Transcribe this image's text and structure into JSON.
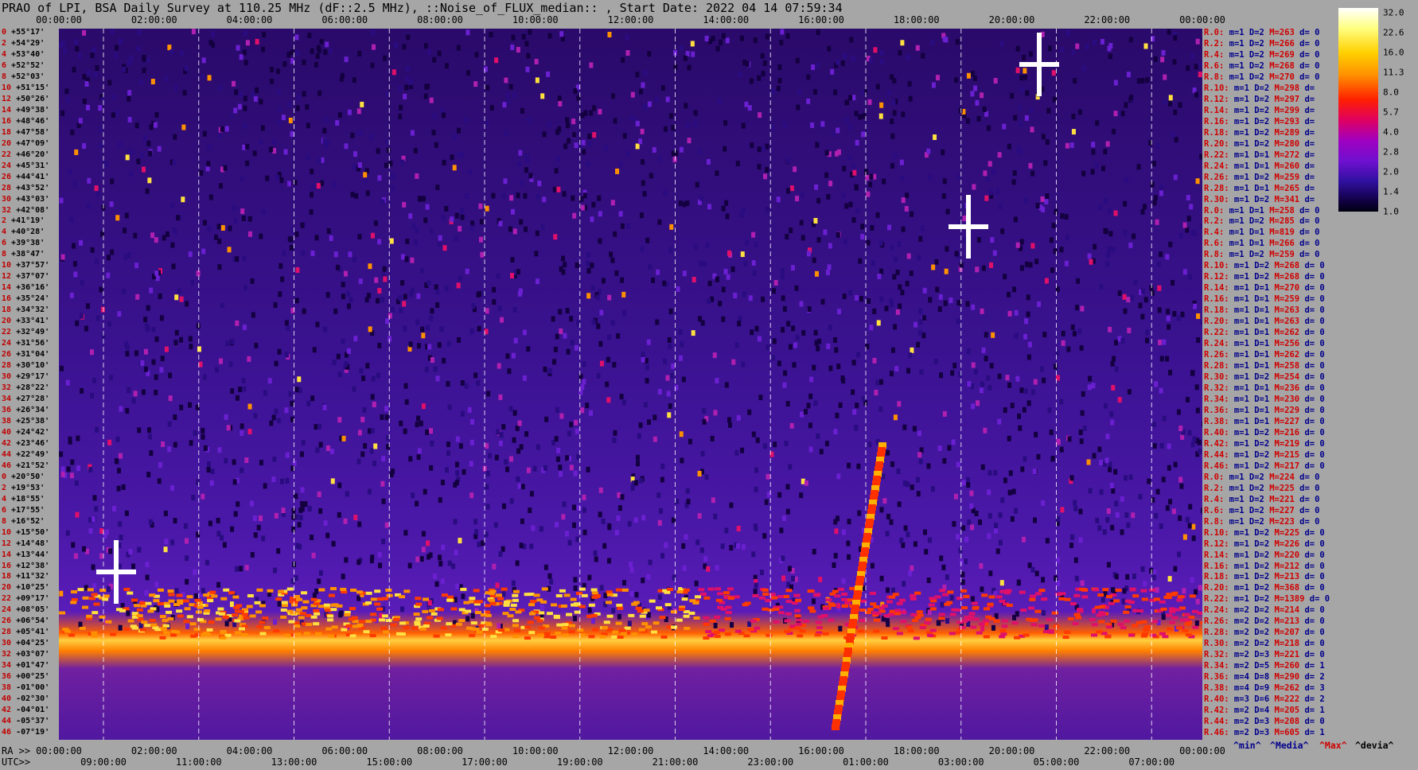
{
  "title": "PRAO of LPI, BSA Daily Survey at 110.25 MHz (dF::2.5 MHz), ::Noise_of_FLUX_median:: , Start Date: 2022 04 14 07:59:34",
  "chart_data": {
    "type": "heatmap",
    "title": "PRAO of LPI, BSA Daily Survey at 110.25 MHz (dF::2.5 MHz), ::Noise_of_FLUX_median:: , Start Date: 2022 04 14 07:59:34",
    "x_top_ticks": [
      "00:00:00",
      "02:00:00",
      "04:00:00",
      "06:00:00",
      "08:00:00",
      "10:00:00",
      "12:00:00",
      "14:00:00",
      "16:00:00",
      "18:00:00",
      "20:00:00",
      "22:00:00",
      "00:00:00"
    ],
    "x_bottom_ra_ticks": [
      "00:00:00",
      "02:00:00",
      "04:00:00",
      "06:00:00",
      "08:00:00",
      "10:00:00",
      "12:00:00",
      "14:00:00",
      "16:00:00",
      "18:00:00",
      "20:00:00",
      "22:00:00",
      "00:00:00"
    ],
    "x_bottom_utc_ticks": [
      "09:00:00",
      "11:00:00",
      "13:00:00",
      "15:00:00",
      "17:00:00",
      "19:00:00",
      "21:00:00",
      "23:00:00",
      "01:00:00",
      "03:00:00",
      "05:00:00",
      "07:00:00"
    ],
    "ra_label": "RA >>",
    "utc_label": "UTC>>",
    "declinations": [
      {
        "i": "0",
        "d": "+55°17'"
      },
      {
        "i": "2",
        "d": "+54°29'"
      },
      {
        "i": "4",
        "d": "+53°40'"
      },
      {
        "i": "6",
        "d": "+52°52'"
      },
      {
        "i": "8",
        "d": "+52°03'"
      },
      {
        "i": "10",
        "d": "+51°15'"
      },
      {
        "i": "12",
        "d": "+50°26'"
      },
      {
        "i": "14",
        "d": "+49°38'"
      },
      {
        "i": "16",
        "d": "+48°46'"
      },
      {
        "i": "18",
        "d": "+47°58'"
      },
      {
        "i": "20",
        "d": "+47°09'"
      },
      {
        "i": "22",
        "d": "+46°20'"
      },
      {
        "i": "24",
        "d": "+45°31'"
      },
      {
        "i": "26",
        "d": "+44°41'"
      },
      {
        "i": "28",
        "d": "+43°52'"
      },
      {
        "i": "30",
        "d": "+43°03'"
      },
      {
        "i": "32",
        "d": "+42°08'"
      },
      {
        "i": "2",
        "d": "+41°19'"
      },
      {
        "i": "4",
        "d": "+40°28'"
      },
      {
        "i": "6",
        "d": "+39°38'"
      },
      {
        "i": "8",
        "d": "+38°47'"
      },
      {
        "i": "10",
        "d": "+37°57'"
      },
      {
        "i": "12",
        "d": "+37°07'"
      },
      {
        "i": "14",
        "d": "+36°16'"
      },
      {
        "i": "16",
        "d": "+35°24'"
      },
      {
        "i": "18",
        "d": "+34°32'"
      },
      {
        "i": "20",
        "d": "+33°41'"
      },
      {
        "i": "22",
        "d": "+32°49'"
      },
      {
        "i": "24",
        "d": "+31°56'"
      },
      {
        "i": "26",
        "d": "+31°04'"
      },
      {
        "i": "28",
        "d": "+30°10'"
      },
      {
        "i": "30",
        "d": "+29°17'"
      },
      {
        "i": "32",
        "d": "+28°22'"
      },
      {
        "i": "34",
        "d": "+27°28'"
      },
      {
        "i": "36",
        "d": "+26°34'"
      },
      {
        "i": "38",
        "d": "+25°38'"
      },
      {
        "i": "40",
        "d": "+24°42'"
      },
      {
        "i": "42",
        "d": "+23°46'"
      },
      {
        "i": "44",
        "d": "+22°49'"
      },
      {
        "i": "46",
        "d": "+21°52'"
      },
      {
        "i": "0",
        "d": "+20°50'"
      },
      {
        "i": "2",
        "d": "+19°53'"
      },
      {
        "i": "4",
        "d": "+18°55'"
      },
      {
        "i": "6",
        "d": "+17°55'"
      },
      {
        "i": "8",
        "d": "+16°52'"
      },
      {
        "i": "10",
        "d": "+15°50'"
      },
      {
        "i": "12",
        "d": "+14°48'"
      },
      {
        "i": "14",
        "d": "+13°44'"
      },
      {
        "i": "16",
        "d": "+12°38'"
      },
      {
        "i": "18",
        "d": "+11°32'"
      },
      {
        "i": "20",
        "d": "+10°25'"
      },
      {
        "i": "22",
        "d": "+09°17'"
      },
      {
        "i": "24",
        "d": "+08°05'"
      },
      {
        "i": "26",
        "d": "+06°54'"
      },
      {
        "i": "28",
        "d": "+05°41'"
      },
      {
        "i": "30",
        "d": "+04°25'"
      },
      {
        "i": "32",
        "d": "+03°07'"
      },
      {
        "i": "34",
        "d": "+01°47'"
      },
      {
        "i": "36",
        "d": "+00°25'"
      },
      {
        "i": "38",
        "d": "-01°00'"
      },
      {
        "i": "40",
        "d": "-02°30'"
      },
      {
        "i": "42",
        "d": "-04°01'"
      },
      {
        "i": "44",
        "d": "-05°37'"
      },
      {
        "i": "46",
        "d": "-07°19'"
      }
    ],
    "right_stats": [
      {
        "r": "R.0:",
        "m": "m=1",
        "dd": "D=2",
        "mx": "M=263",
        "dv": "d= 0"
      },
      {
        "r": "R.2:",
        "m": "m=1",
        "dd": "D=2",
        "mx": "M=266",
        "dv": "d= 0"
      },
      {
        "r": "R.4:",
        "m": "m=1",
        "dd": "D=2",
        "mx": "M=269",
        "dv": "d= 0"
      },
      {
        "r": "R.6:",
        "m": "m=1",
        "dd": "D=2",
        "mx": "M=268",
        "dv": "d= 0"
      },
      {
        "r": "R.8:",
        "m": "m=1",
        "dd": "D=2",
        "mx": "M=270",
        "dv": "d= 0"
      },
      {
        "r": "R.10:",
        "m": "m=1",
        "dd": "D=2",
        "mx": "M=298",
        "dv": "d="
      },
      {
        "r": "R.12:",
        "m": "m=1",
        "dd": "D=2",
        "mx": "M=297",
        "dv": "d="
      },
      {
        "r": "R.14:",
        "m": "m=1",
        "dd": "D=2",
        "mx": "M=299",
        "dv": "d="
      },
      {
        "r": "R.16:",
        "m": "m=1",
        "dd": "D=2",
        "mx": "M=293",
        "dv": "d="
      },
      {
        "r": "R.18:",
        "m": "m=1",
        "dd": "D=2",
        "mx": "M=289",
        "dv": "d="
      },
      {
        "r": "R.20:",
        "m": "m=1",
        "dd": "D=2",
        "mx": "M=280",
        "dv": "d="
      },
      {
        "r": "R.22:",
        "m": "m=1",
        "dd": "D=1",
        "mx": "M=272",
        "dv": "d="
      },
      {
        "r": "R.24:",
        "m": "m=1",
        "dd": "D=1",
        "mx": "M=260",
        "dv": "d="
      },
      {
        "r": "R.26:",
        "m": "m=1",
        "dd": "D=2",
        "mx": "M=259",
        "dv": "d="
      },
      {
        "r": "R.28:",
        "m": "m=1",
        "dd": "D=1",
        "mx": "M=265",
        "dv": "d="
      },
      {
        "r": "R.30:",
        "m": "m=1",
        "dd": "D=2",
        "mx": "M=341",
        "dv": "d="
      },
      {
        "r": "R.0:",
        "m": "m=1",
        "dd": "D=1",
        "mx": "M=258",
        "dv": "d= 0"
      },
      {
        "r": "R.2:",
        "m": "m=1",
        "dd": "D=2",
        "mx": "M=285",
        "dv": "d= 0"
      },
      {
        "r": "R.4:",
        "m": "m=1",
        "dd": "D=1",
        "mx": "M=819",
        "dv": "d= 0"
      },
      {
        "r": "R.6:",
        "m": "m=1",
        "dd": "D=1",
        "mx": "M=266",
        "dv": "d= 0"
      },
      {
        "r": "R.8:",
        "m": "m=1",
        "dd": "D=2",
        "mx": "M=259",
        "dv": "d= 0"
      },
      {
        "r": "R.10:",
        "m": "m=1",
        "dd": "D=2",
        "mx": "M=268",
        "dv": "d= 0"
      },
      {
        "r": "R.12:",
        "m": "m=1",
        "dd": "D=2",
        "mx": "M=268",
        "dv": "d= 0"
      },
      {
        "r": "R.14:",
        "m": "m=1",
        "dd": "D=1",
        "mx": "M=270",
        "dv": "d= 0"
      },
      {
        "r": "R.16:",
        "m": "m=1",
        "dd": "D=1",
        "mx": "M=259",
        "dv": "d= 0"
      },
      {
        "r": "R.18:",
        "m": "m=1",
        "dd": "D=1",
        "mx": "M=263",
        "dv": "d= 0"
      },
      {
        "r": "R.20:",
        "m": "m=1",
        "dd": "D=1",
        "mx": "M=263",
        "dv": "d= 0"
      },
      {
        "r": "R.22:",
        "m": "m=1",
        "dd": "D=1",
        "mx": "M=262",
        "dv": "d= 0"
      },
      {
        "r": "R.24:",
        "m": "m=1",
        "dd": "D=1",
        "mx": "M=256",
        "dv": "d= 0"
      },
      {
        "r": "R.26:",
        "m": "m=1",
        "dd": "D=1",
        "mx": "M=262",
        "dv": "d= 0"
      },
      {
        "r": "R.28:",
        "m": "m=1",
        "dd": "D=1",
        "mx": "M=258",
        "dv": "d= 0"
      },
      {
        "r": "R.30:",
        "m": "m=1",
        "dd": "D=2",
        "mx": "M=254",
        "dv": "d= 0"
      },
      {
        "r": "R.32:",
        "m": "m=1",
        "dd": "D=1",
        "mx": "M=236",
        "dv": "d= 0"
      },
      {
        "r": "R.34:",
        "m": "m=1",
        "dd": "D=1",
        "mx": "M=230",
        "dv": "d= 0"
      },
      {
        "r": "R.36:",
        "m": "m=1",
        "dd": "D=1",
        "mx": "M=229",
        "dv": "d= 0"
      },
      {
        "r": "R.38:",
        "m": "m=1",
        "dd": "D=1",
        "mx": "M=227",
        "dv": "d= 0"
      },
      {
        "r": "R.40:",
        "m": "m=1",
        "dd": "D=2",
        "mx": "M=216",
        "dv": "d= 0"
      },
      {
        "r": "R.42:",
        "m": "m=1",
        "dd": "D=2",
        "mx": "M=219",
        "dv": "d= 0"
      },
      {
        "r": "R.44:",
        "m": "m=1",
        "dd": "D=2",
        "mx": "M=215",
        "dv": "d= 0"
      },
      {
        "r": "R.46:",
        "m": "m=1",
        "dd": "D=2",
        "mx": "M=217",
        "dv": "d= 0"
      },
      {
        "r": "R.0:",
        "m": "m=1",
        "dd": "D=2",
        "mx": "M=224",
        "dv": "d= 0"
      },
      {
        "r": "R.2:",
        "m": "m=1",
        "dd": "D=2",
        "mx": "M=225",
        "dv": "d= 0"
      },
      {
        "r": "R.4:",
        "m": "m=1",
        "dd": "D=2",
        "mx": "M=221",
        "dv": "d= 0"
      },
      {
        "r": "R.6:",
        "m": "m=1",
        "dd": "D=2",
        "mx": "M=227",
        "dv": "d= 0"
      },
      {
        "r": "R.8:",
        "m": "m=1",
        "dd": "D=2",
        "mx": "M=223",
        "dv": "d= 0"
      },
      {
        "r": "R.10:",
        "m": "m=1",
        "dd": "D=2",
        "mx": "M=225",
        "dv": "d= 0"
      },
      {
        "r": "R.12:",
        "m": "m=1",
        "dd": "D=2",
        "mx": "M=226",
        "dv": "d= 0"
      },
      {
        "r": "R.14:",
        "m": "m=1",
        "dd": "D=2",
        "mx": "M=220",
        "dv": "d= 0"
      },
      {
        "r": "R.16:",
        "m": "m=1",
        "dd": "D=2",
        "mx": "M=212",
        "dv": "d= 0"
      },
      {
        "r": "R.18:",
        "m": "m=1",
        "dd": "D=2",
        "mx": "M=213",
        "dv": "d= 0"
      },
      {
        "r": "R.20:",
        "m": "m=1",
        "dd": "D=2",
        "mx": "M=368",
        "dv": "d= 0"
      },
      {
        "r": "R.22:",
        "m": "m=1",
        "dd": "D=2",
        "mx": "M=1389",
        "dv": "d= 0"
      },
      {
        "r": "R.24:",
        "m": "m=2",
        "dd": "D=2",
        "mx": "M=214",
        "dv": "d= 0"
      },
      {
        "r": "R.26:",
        "m": "m=2",
        "dd": "D=2",
        "mx": "M=213",
        "dv": "d= 0"
      },
      {
        "r": "R.28:",
        "m": "m=2",
        "dd": "D=2",
        "mx": "M=207",
        "dv": "d= 0"
      },
      {
        "r": "R.30:",
        "m": "m=2",
        "dd": "D=2",
        "mx": "M=218",
        "dv": "d= 0"
      },
      {
        "r": "R.32:",
        "m": "m=2",
        "dd": "D=3",
        "mx": "M=221",
        "dv": "d= 0"
      },
      {
        "r": "R.34:",
        "m": "m=2",
        "dd": "D=5",
        "mx": "M=260",
        "dv": "d= 1"
      },
      {
        "r": "R.36:",
        "m": "m=4",
        "dd": "D=8",
        "mx": "M=290",
        "dv": "d= 2"
      },
      {
        "r": "R.38:",
        "m": "m=4",
        "dd": "D=9",
        "mx": "M=262",
        "dv": "d= 3"
      },
      {
        "r": "R.40:",
        "m": "m=3",
        "dd": "D=6",
        "mx": "M=222",
        "dv": "d= 2"
      },
      {
        "r": "R.42:",
        "m": "m=2",
        "dd": "D=4",
        "mx": "M=205",
        "dv": "d= 1"
      },
      {
        "r": "R.44:",
        "m": "m=2",
        "dd": "D=3",
        "mx": "M=208",
        "dv": "d= 0"
      },
      {
        "r": "R.46:",
        "m": "m=2",
        "dd": "D=3",
        "mx": "M=605",
        "dv": "d= 1"
      }
    ],
    "colorbar_ticks": [
      "32.0",
      "22.6",
      "16.0",
      "11.3",
      "8.0",
      "5.7",
      "4.0",
      "2.8",
      "2.0",
      "1.4",
      "1.0"
    ],
    "legend": {
      "min": "^min^",
      "median": "^Media^",
      "max": "^Max^",
      "dev": "^devia^"
    },
    "colors": {
      "background": "#a6a6a6",
      "low": "#0a0030",
      "mid": "#7010d0",
      "high": "#ff2000",
      "peak": "#ffffff"
    }
  }
}
